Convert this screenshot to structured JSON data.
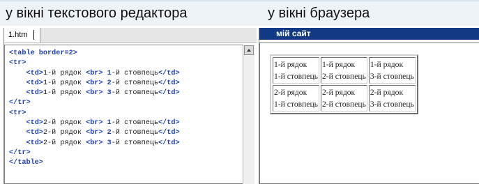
{
  "captions": {
    "left": "у вікні текстового редактора",
    "right": "у вікні браузера"
  },
  "editor": {
    "tab_label": "1.htm",
    "code_lines": [
      [
        {
          "t": "tag",
          "v": "<table border=2>"
        }
      ],
      [
        {
          "t": "tag",
          "v": "<tr>"
        }
      ],
      [
        {
          "t": "txt",
          "v": "    "
        },
        {
          "t": "tag",
          "v": "<td>"
        },
        {
          "t": "txt",
          "v": "1-й рядок "
        },
        {
          "t": "tag",
          "v": "<br>"
        },
        {
          "t": "txt",
          "v": " "
        },
        {
          "t": "tag",
          "v": "1"
        },
        {
          "t": "txt",
          "v": "-й стовпець"
        },
        {
          "t": "tag",
          "v": "</td>"
        }
      ],
      [
        {
          "t": "txt",
          "v": "    "
        },
        {
          "t": "tag",
          "v": "<td>"
        },
        {
          "t": "txt",
          "v": "1-й рядок "
        },
        {
          "t": "tag",
          "v": "<br>"
        },
        {
          "t": "txt",
          "v": " "
        },
        {
          "t": "tag",
          "v": "2"
        },
        {
          "t": "txt",
          "v": "-й стовпець"
        },
        {
          "t": "tag",
          "v": "</td>"
        }
      ],
      [
        {
          "t": "txt",
          "v": "    "
        },
        {
          "t": "tag",
          "v": "<td>"
        },
        {
          "t": "txt",
          "v": "1-й рядок "
        },
        {
          "t": "tag",
          "v": "<br>"
        },
        {
          "t": "txt",
          "v": " "
        },
        {
          "t": "tag",
          "v": "3"
        },
        {
          "t": "txt",
          "v": "-й стовпець"
        },
        {
          "t": "tag",
          "v": "</td>"
        }
      ],
      [
        {
          "t": "tag",
          "v": "</tr>"
        }
      ],
      [
        {
          "t": "tag",
          "v": "<tr>"
        }
      ],
      [
        {
          "t": "txt",
          "v": "    "
        },
        {
          "t": "tag",
          "v": "<td>"
        },
        {
          "t": "txt",
          "v": "2-й рядок "
        },
        {
          "t": "tag",
          "v": "<br>"
        },
        {
          "t": "txt",
          "v": " "
        },
        {
          "t": "tag",
          "v": "1"
        },
        {
          "t": "txt",
          "v": "-й стовпець"
        },
        {
          "t": "tag",
          "v": "</td>"
        }
      ],
      [
        {
          "t": "txt",
          "v": "    "
        },
        {
          "t": "tag",
          "v": "<td>"
        },
        {
          "t": "txt",
          "v": "2-й рядок "
        },
        {
          "t": "tag",
          "v": "<br>"
        },
        {
          "t": "txt",
          "v": " "
        },
        {
          "t": "tag",
          "v": "2"
        },
        {
          "t": "txt",
          "v": "-й стовпець"
        },
        {
          "t": "tag",
          "v": "</td>"
        }
      ],
      [
        {
          "t": "txt",
          "v": "    "
        },
        {
          "t": "tag",
          "v": "<td>"
        },
        {
          "t": "txt",
          "v": "2-й рядок "
        },
        {
          "t": "tag",
          "v": "<br>"
        },
        {
          "t": "txt",
          "v": " "
        },
        {
          "t": "tag",
          "v": "3"
        },
        {
          "t": "txt",
          "v": "-й стовпець"
        },
        {
          "t": "tag",
          "v": "</td>"
        }
      ],
      [
        {
          "t": "tag",
          "v": "</tr>"
        }
      ],
      [
        {
          "t": "tag",
          "v": "</table>"
        }
      ]
    ]
  },
  "browser": {
    "title": "мій сайт",
    "table_rows": [
      [
        {
          "line1": "1-й рядок",
          "line2": "1-й стовпець"
        },
        {
          "line1": "1-й рядок",
          "line2": "2-й стовпець"
        },
        {
          "line1": "1-й рядок",
          "line2": "3-й стовпець"
        }
      ],
      [
        {
          "line1": "2-й рядок",
          "line2": "1-й стовпець"
        },
        {
          "line1": "2-й рядок",
          "line2": "2-й стовпець"
        },
        {
          "line1": "2-й рядок",
          "line2": "3-й стовпець"
        }
      ]
    ]
  },
  "colors": {
    "title_bar": "#123a84",
    "code_tag": "#1f3fb3",
    "top_band": "#eef3f8"
  }
}
